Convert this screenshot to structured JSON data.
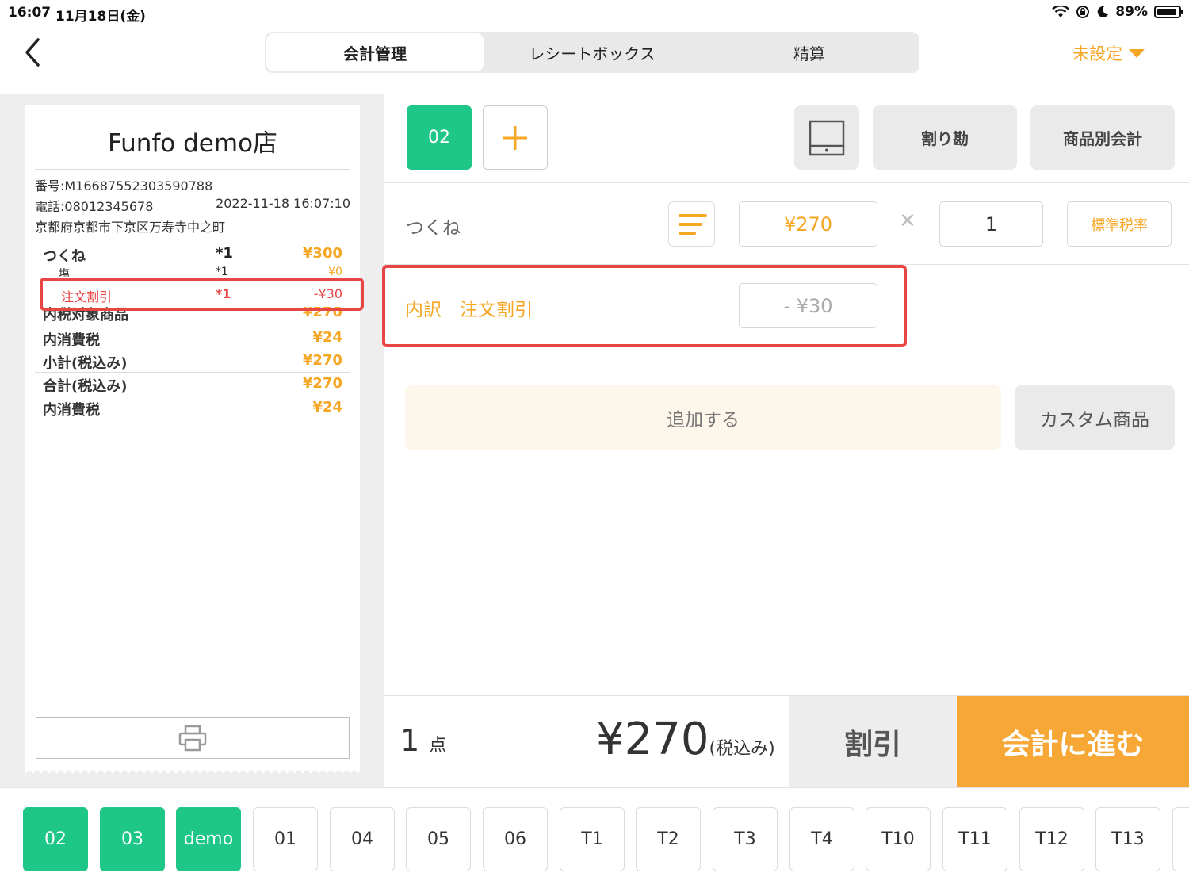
{
  "status": {
    "time": "16:07",
    "date": "11月18日(金)",
    "battery": "89%",
    "battery_level": 0.89
  },
  "header": {
    "tabs": [
      {
        "label": "会計管理",
        "active": true
      },
      {
        "label": "レシートボックス",
        "active": false
      },
      {
        "label": "精算",
        "active": false
      }
    ],
    "setting": "未設定"
  },
  "receipt": {
    "store": "Funfo demo店",
    "number": "番号:M16687552303590788",
    "phone": "電話:08012345678",
    "datetime": "2022-11-18 16:07:10",
    "address": "京都府京都市下京区万寿寺中之町",
    "lines": [
      {
        "name": "つくね",
        "qty": "*1",
        "value": "¥300"
      },
      {
        "name": "塩",
        "qty": "*1",
        "value": "¥0"
      },
      {
        "name": "注文割引",
        "qty": "*1",
        "value": "-¥30"
      },
      {
        "name": "内税対象商品",
        "value": "¥270"
      },
      {
        "name": "内消費税",
        "value": "¥24"
      },
      {
        "name": "小計(税込み)",
        "value": "¥270"
      },
      {
        "name": "合計(税込み)",
        "value": "¥270"
      },
      {
        "name": "内消費税",
        "value": "¥24"
      }
    ]
  },
  "order": {
    "current_tab": "02",
    "actions": {
      "split": "割り勘",
      "by_item": "商品別会計"
    },
    "item": {
      "name": "つくね",
      "price": "¥270",
      "qty": "1",
      "tax": "標準税率"
    },
    "breakdown": {
      "label": "内訳　注文割引",
      "value": "- ¥30"
    },
    "add_label": "追加する",
    "custom_label": "カスタム商品",
    "count": "1",
    "count_unit": "点",
    "total": "¥270",
    "total_suffix": "(税込み)",
    "discount_label": "割引",
    "checkout_label": "会計に進む"
  },
  "tables": [
    {
      "label": "02",
      "active": true
    },
    {
      "label": "03",
      "active": true
    },
    {
      "label": "demo",
      "active": true
    },
    {
      "label": "01",
      "active": false
    },
    {
      "label": "04",
      "active": false
    },
    {
      "label": "05",
      "active": false
    },
    {
      "label": "06",
      "active": false
    },
    {
      "label": "T1",
      "active": false
    },
    {
      "label": "T2",
      "active": false
    },
    {
      "label": "T3",
      "active": false
    },
    {
      "label": "T4",
      "active": false
    },
    {
      "label": "T10",
      "active": false
    },
    {
      "label": "T11",
      "active": false
    },
    {
      "label": "T12",
      "active": false
    },
    {
      "label": "T13",
      "active": false
    }
  ],
  "colors": {
    "accent": "#f5a623",
    "green": "#1ec687",
    "highlight": "#e84545"
  }
}
